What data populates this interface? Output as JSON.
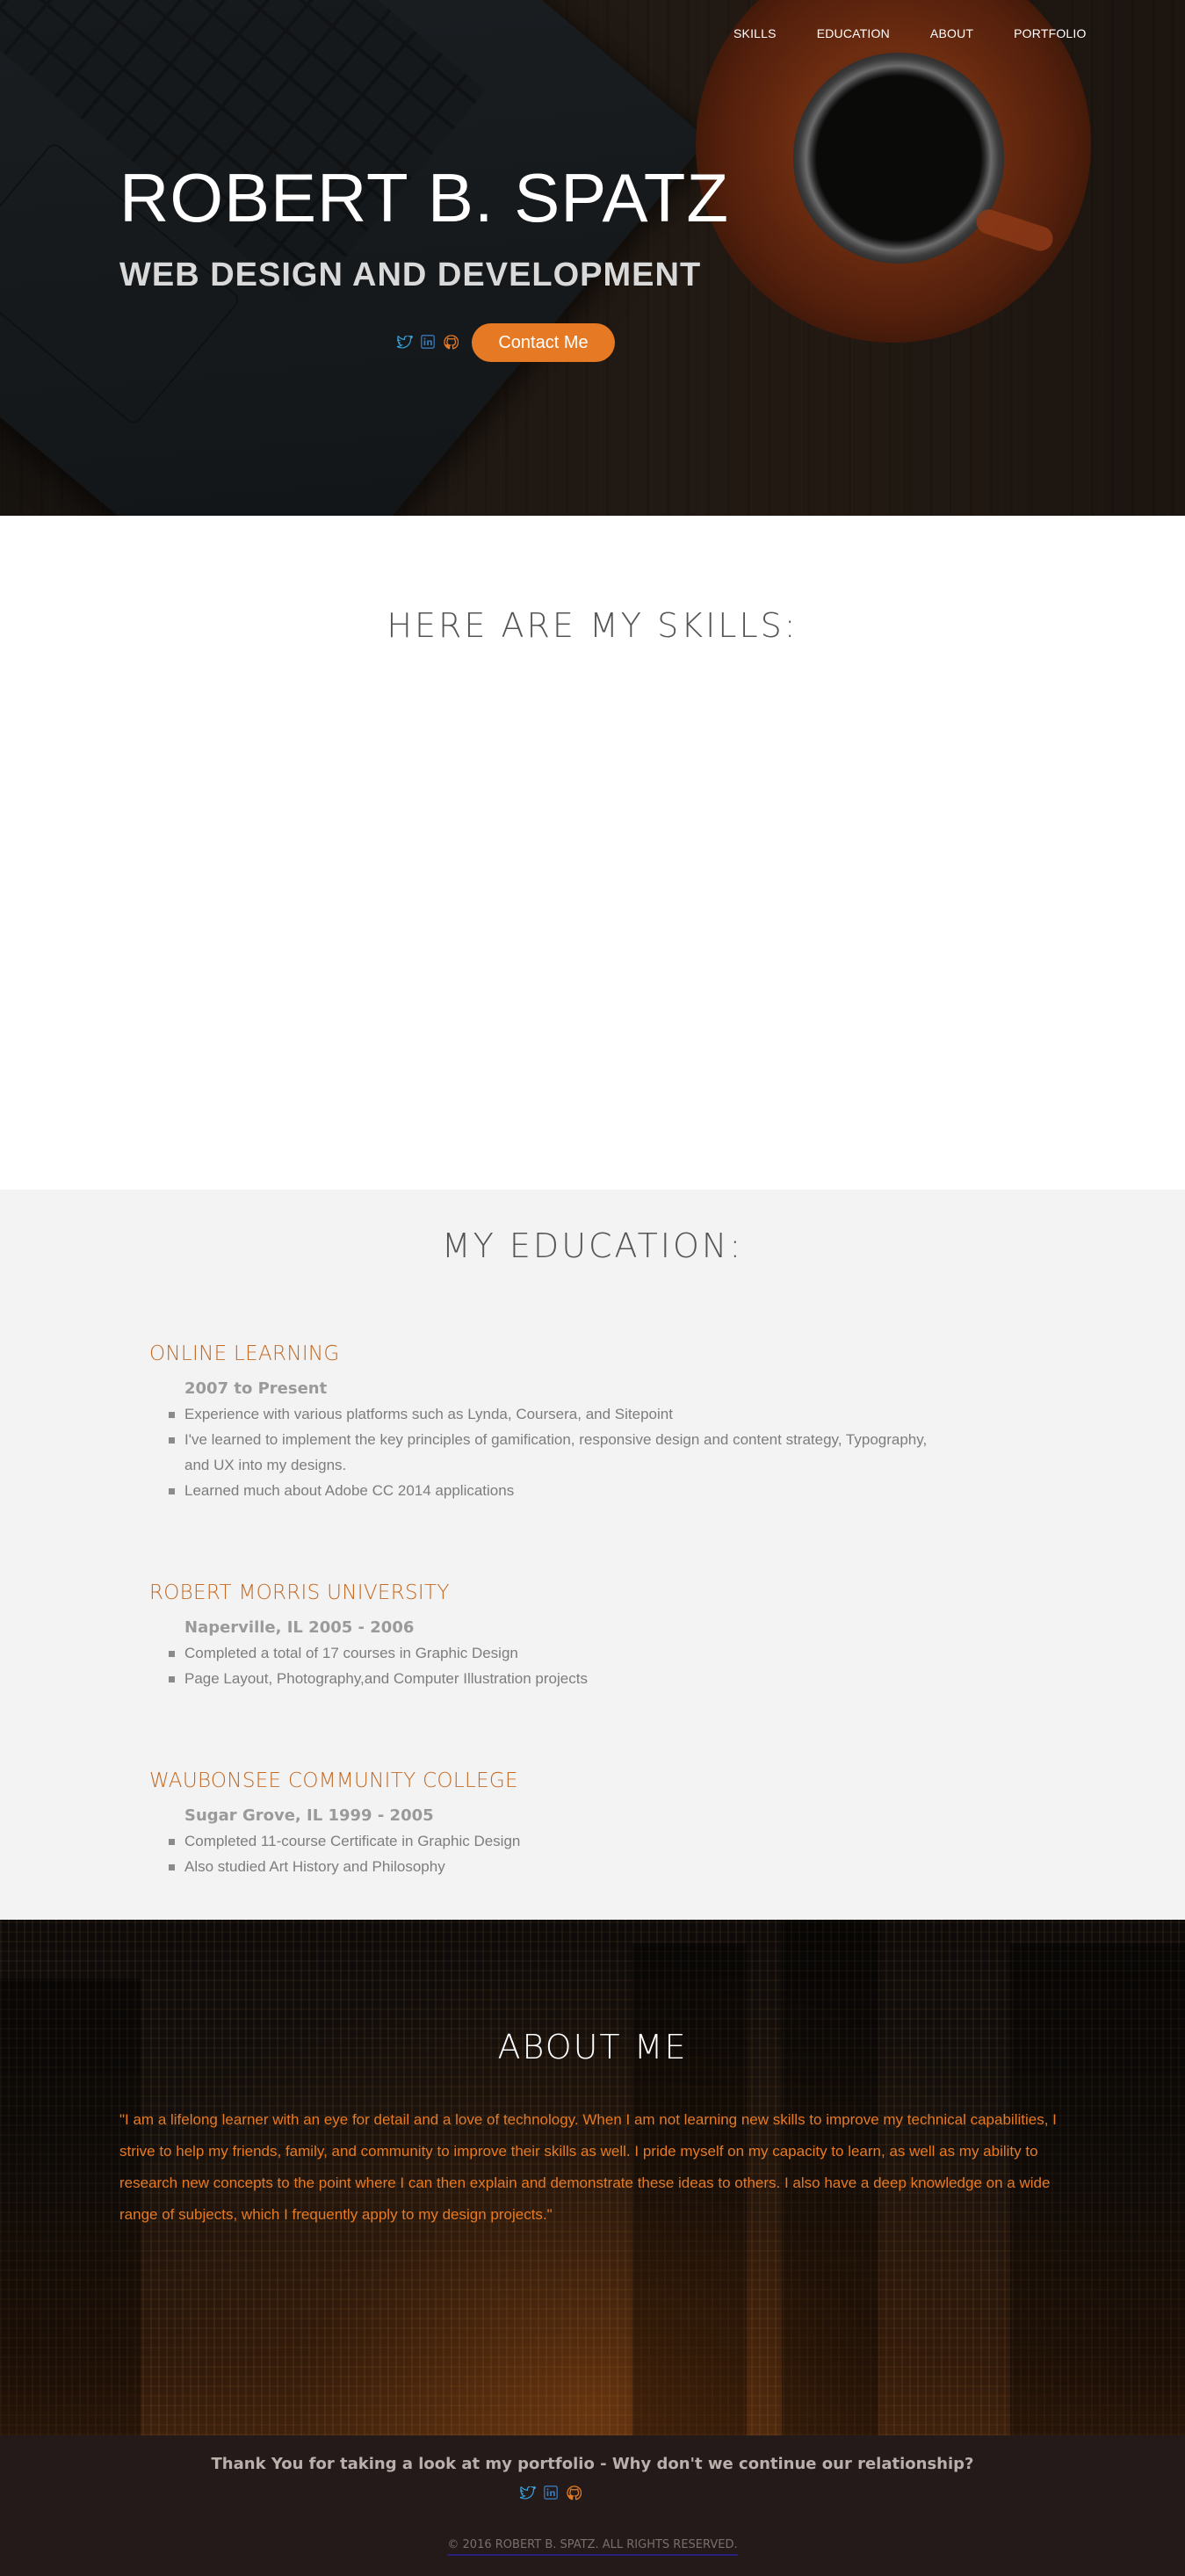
{
  "nav": {
    "items": [
      "SKILLS",
      "EDUCATION",
      "ABOUT",
      "PORTFOLIO"
    ]
  },
  "hero": {
    "name": "ROBERT B. SPATZ",
    "subtitle": "WEB DESIGN AND DEVELOPMENT",
    "contact_label": "Contact Me",
    "social_icons": [
      "twitter-icon",
      "linkedin-icon",
      "github-icon"
    ]
  },
  "skills": {
    "title": "HERE ARE MY SKILLS:"
  },
  "education": {
    "title": "MY EDUCATION:",
    "entries": [
      {
        "name": "ONLINE LEARNING",
        "date": "2007 to Present",
        "items": [
          "Experience with various platforms such as Lynda, Coursera, and Sitepoint",
          "I've learned to implement the key principles of gamification, responsive design and content strategy, Typography, and UX into my designs.",
          "Learned much about Adobe CC 2014 applications"
        ]
      },
      {
        "name": "ROBERT MORRIS UNIVERSITY",
        "date": "Naperville, IL 2005 - 2006",
        "items": [
          "Completed a total of 17 courses in Graphic Design",
          "Page Layout, Photography,and Computer Illustration projects"
        ]
      },
      {
        "name": "WAUBONSEE COMMUNITY COLLEGE",
        "date": "Sugar Grove, IL 1999 - 2005",
        "items": [
          "Completed 11-course Certificate in Graphic Design",
          "Also studied Art History and Philosophy"
        ]
      }
    ]
  },
  "about": {
    "title": "ABOUT ME",
    "text": "\"I am a lifelong learner with an eye for detail and a love of technology. When I am not learning new skills to improve my technical capabilities, I strive to help my friends, family, and community to improve their skills as well. I pride myself on my capacity to learn, as well as my ability to research new concepts to the point where I can then explain and demonstrate these ideas to others. I also have a deep knowledge on a wide range of subjects, which I frequently apply to my design projects.\""
  },
  "footer": {
    "message": "Thank You for taking a look at my portfolio - Why don't we continue our relationship?",
    "copyright": "© 2016 ROBERT B. SPATZ. ALL RIGHTS RESERVED."
  },
  "colors": {
    "accent": "#e67a24",
    "edu_heading": "#c46a24",
    "twitter": "#3aa0d8",
    "linkedin": "#3a78b8",
    "github": "#e67a24",
    "footer_bg": "#241a1a"
  }
}
